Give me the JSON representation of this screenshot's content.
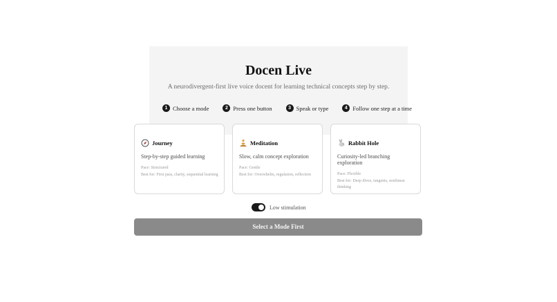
{
  "app": {
    "title": "Docen Live",
    "subtitle": "A neurodivergent-first live voice docent for learning technical concepts step by step."
  },
  "steps": [
    {
      "num": "1",
      "label": "Choose a mode"
    },
    {
      "num": "2",
      "label": "Press one button"
    },
    {
      "num": "3",
      "label": "Speak or type"
    },
    {
      "num": "4",
      "label": "Follow one step at a time"
    }
  ],
  "modes": [
    {
      "name": "Journey",
      "icon": "compass-icon",
      "description": "Step-by-step guided learning",
      "pace": "Pace: Structured",
      "best_for": "Best for: First pass, clarity, sequential learning"
    },
    {
      "name": "Meditation",
      "icon": "meditation-icon",
      "description": "Slow, calm concept exploration",
      "pace": "Pace: Gentle",
      "best_for": "Best for: Overwhelm, regulation, reflection"
    },
    {
      "name": "Rabbit Hole",
      "icon": "rabbit-icon",
      "description": "Curiosity-led branching exploration",
      "pace": "Pace: Flexible",
      "best_for": "Best for: Deep dives, tangents, nonlinear thinking"
    }
  ],
  "low_stimulation": {
    "label": "Low stimulation",
    "enabled": true
  },
  "cta": {
    "label": "Select a Mode First"
  },
  "colors": {
    "accent": "#1a1a1a",
    "cta_disabled": "#8a8a8a",
    "hero_bg": "#f4f4f4"
  }
}
